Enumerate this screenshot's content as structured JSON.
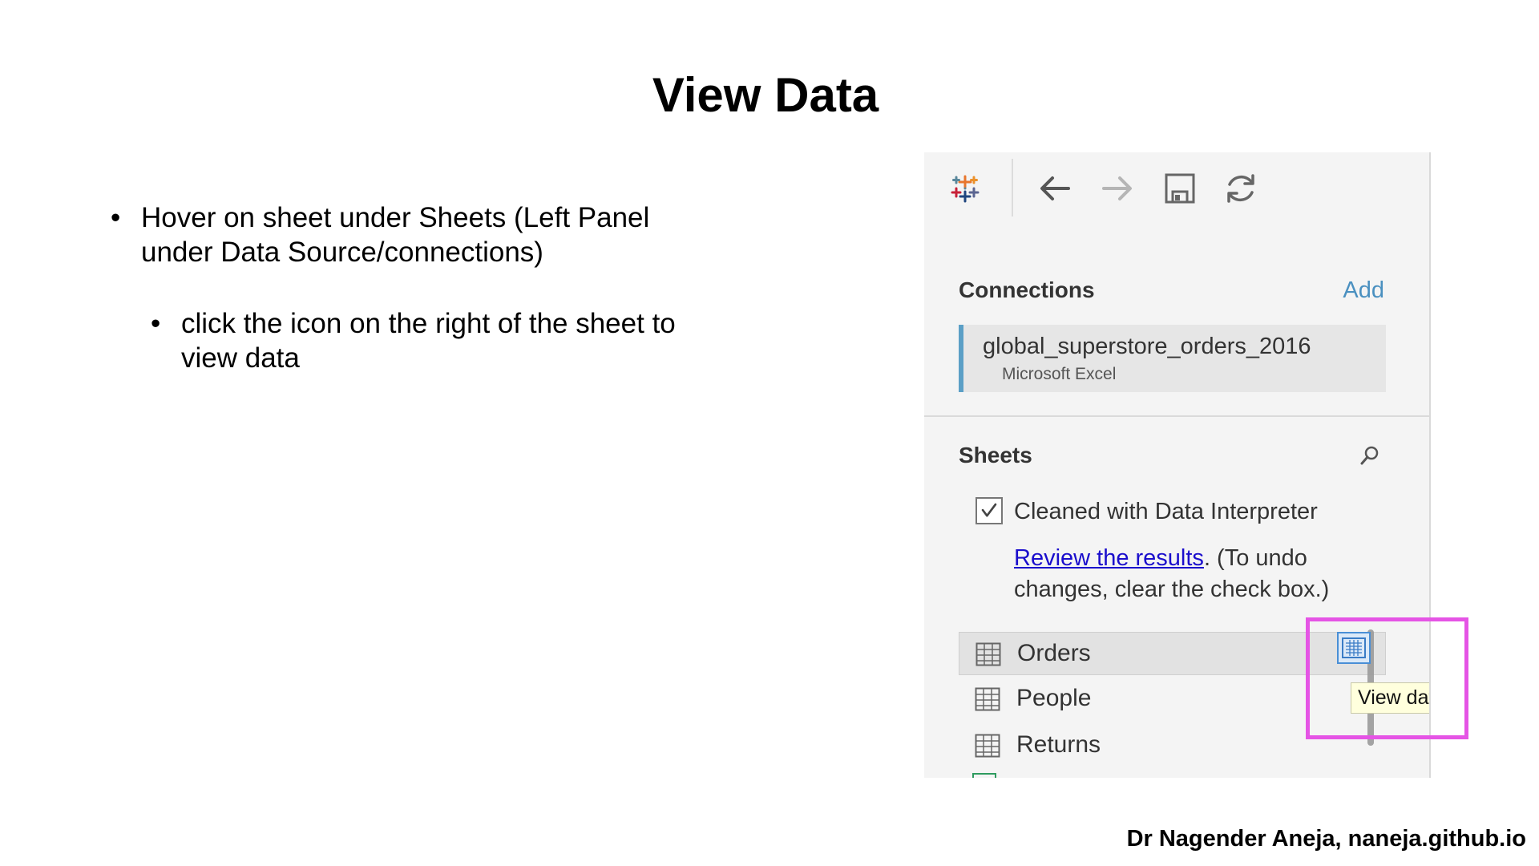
{
  "slide": {
    "title": "View Data",
    "bullets": [
      "Hover on sheet under Sheets (Left Panel under Data Source/connections)",
      "click the icon on the right of the sheet to view data"
    ],
    "footer": "Dr Nagender Aneja, naneja.github.io"
  },
  "panel": {
    "connections": {
      "title": "Connections",
      "add_label": "Add",
      "items": [
        {
          "name": "global_superstore_orders_2016",
          "type": "Microsoft Excel"
        }
      ]
    },
    "sheets": {
      "title": "Sheets",
      "interpreter_label": "Cleaned with Data Interpreter",
      "interpreter_checked": true,
      "review_link": "Review the results",
      "review_rest": ". (To undo changes, clear the check box.)",
      "items": [
        {
          "label": "Orders",
          "active": true
        },
        {
          "label": "People",
          "active": false
        },
        {
          "label": "Returns",
          "active": false
        }
      ]
    },
    "tooltip": "View data"
  },
  "colors": {
    "highlight": "#e554e5",
    "link": "#1a0dcc",
    "add_link": "#4a90c0",
    "connection_accent": "#5b9fc6"
  }
}
